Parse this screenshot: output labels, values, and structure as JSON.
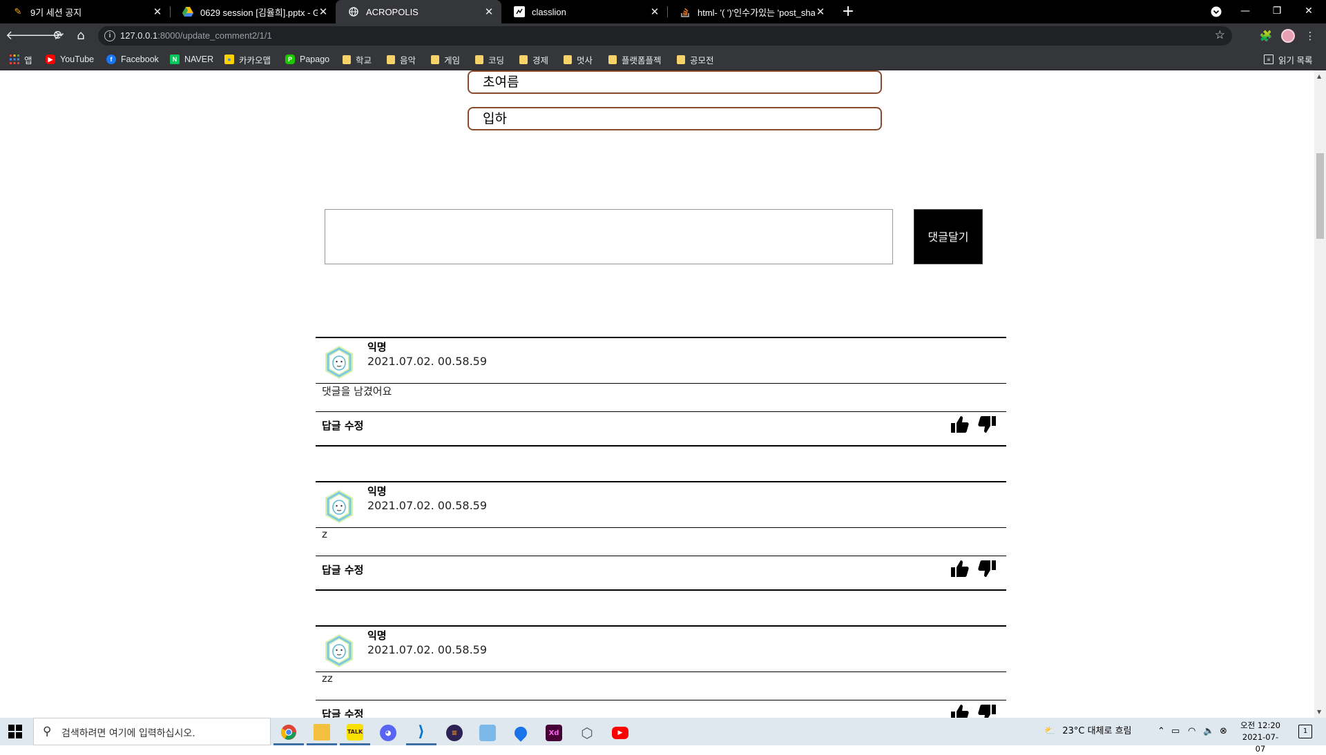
{
  "browser": {
    "tabs": [
      {
        "title": "9기 세션 공지",
        "icon": "pencil-icon",
        "active": false
      },
      {
        "title": "0629 session [김율희].pptx - Go",
        "icon": "google-drive-icon",
        "active": false
      },
      {
        "title": "ACROPOLIS",
        "icon": "globe-icon",
        "active": true
      },
      {
        "title": "classlion",
        "icon": "classlion-icon",
        "active": false
      },
      {
        "title": "html- '( ')'인수가있는 'post_sha",
        "icon": "stackoverflow-icon",
        "active": false
      }
    ],
    "url_host": "127.0.0.1",
    "url_rest": ":8000/update_comment2/1/1",
    "bookmarks": [
      {
        "label": "앱",
        "icon": "apps-grid-icon"
      },
      {
        "label": "YouTube",
        "icon": "youtube-icon"
      },
      {
        "label": "Facebook",
        "icon": "facebook-icon"
      },
      {
        "label": "NAVER",
        "icon": "naver-icon"
      },
      {
        "label": "카카오맵",
        "icon": "kakaomap-icon"
      },
      {
        "label": "Papago",
        "icon": "papago-icon"
      },
      {
        "label": "학교",
        "icon": "folder-icon"
      },
      {
        "label": "음악",
        "icon": "folder-icon"
      },
      {
        "label": "게임",
        "icon": "folder-icon"
      },
      {
        "label": "코딩",
        "icon": "folder-icon"
      },
      {
        "label": "경제",
        "icon": "folder-icon"
      },
      {
        "label": "멋사",
        "icon": "folder-icon"
      },
      {
        "label": "플랫폼플젝",
        "icon": "folder-icon"
      },
      {
        "label": "공모전",
        "icon": "folder-icon"
      }
    ],
    "reading_list": "읽기 목록"
  },
  "page": {
    "options": [
      "초여름",
      "입하"
    ],
    "comment_input_value": "",
    "submit_label": "댓글달기",
    "comments": [
      {
        "author": "익명",
        "date": "2021.07.02. 00.58.59",
        "body": "댓글을 남겼어요",
        "actions": "답글 수정"
      },
      {
        "author": "익명",
        "date": "2021.07.02. 00.58.59",
        "body": "z",
        "actions": "답글 수정"
      },
      {
        "author": "익명",
        "date": "2021.07.02. 00.58.59",
        "body": "zz",
        "actions": "답글 수정"
      }
    ]
  },
  "taskbar": {
    "search_placeholder": "검색하려면 여기에 입력하십시오.",
    "weather": "23°C  대체로 흐림",
    "time": "오전 12:20",
    "date": "2021-07-07",
    "notification_count": "1"
  },
  "colors": {
    "pill_border": "#8b4a2b",
    "tab_active": "#35363a",
    "taskbar": "#dfe7ef"
  }
}
